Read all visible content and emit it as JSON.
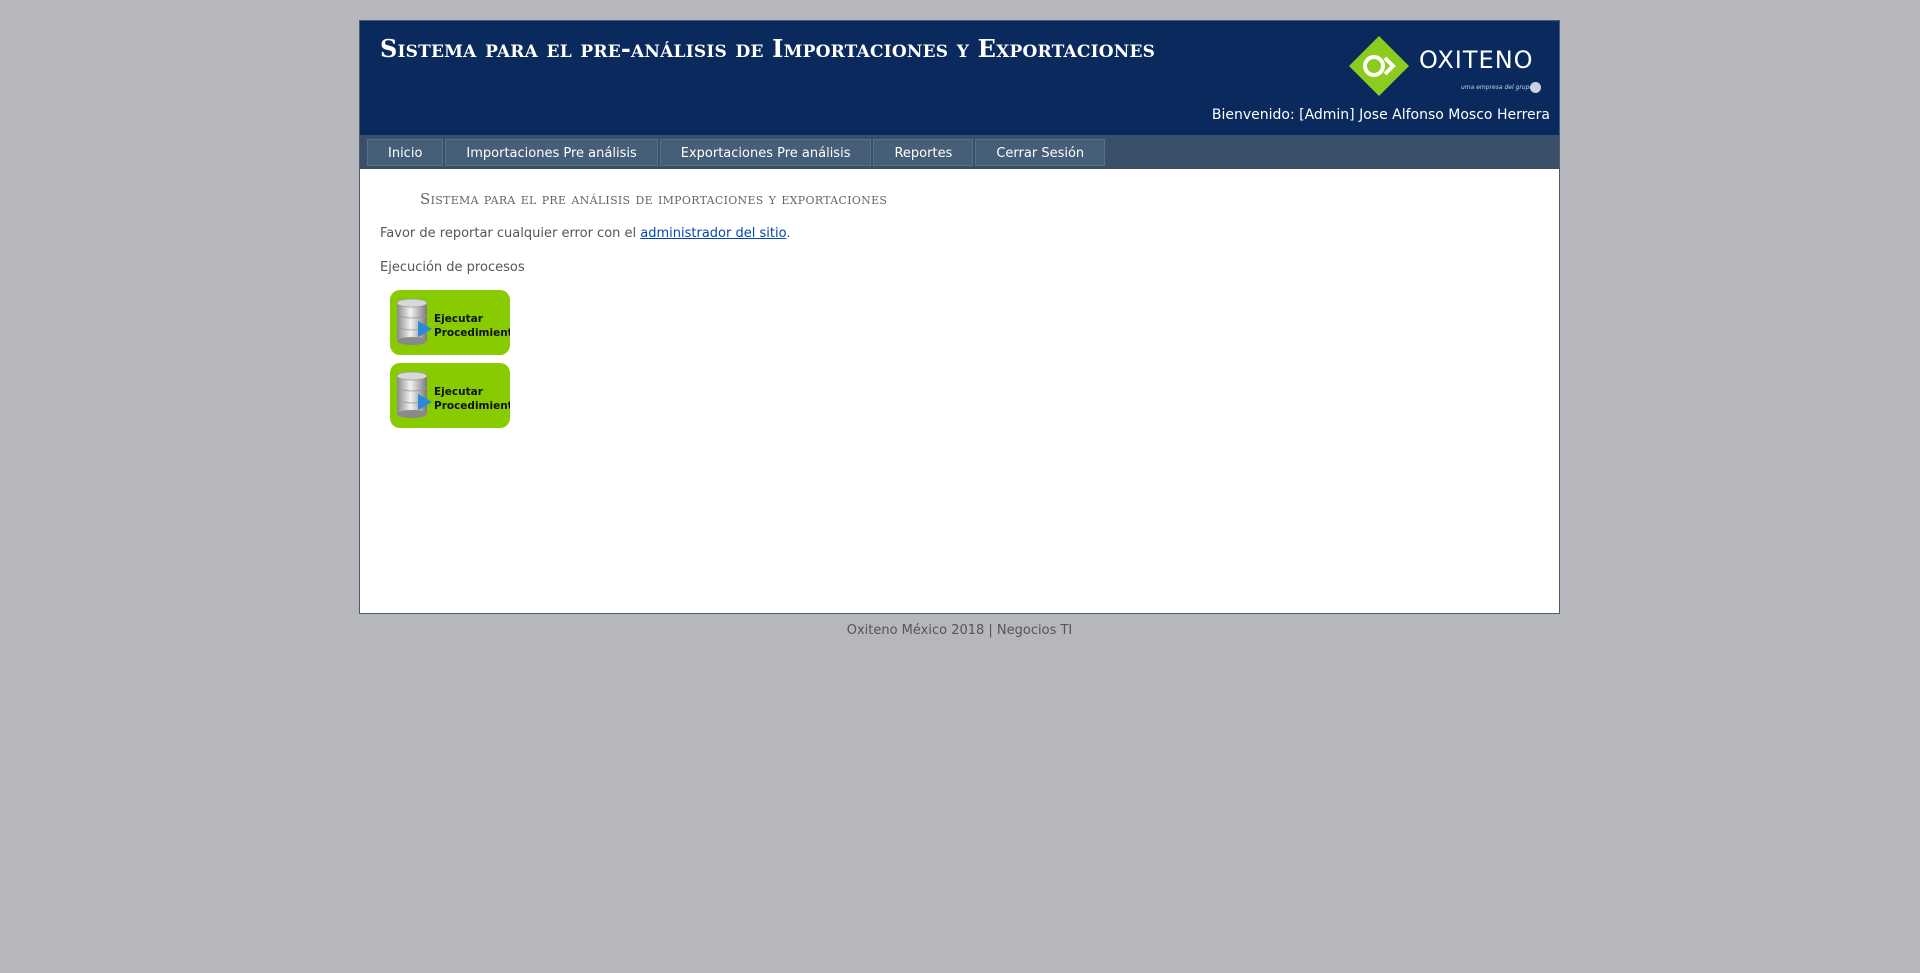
{
  "header": {
    "title": "Sistema para el pre-análisis de Importaciones y Exportaciones",
    "welcome": "Bienvenido: [Admin] Jose Alfonso Mosco Herrera",
    "logo_text": "OXITENO",
    "logo_tagline": "uma empresa del grupo"
  },
  "nav": {
    "items": [
      {
        "label": "Inicio"
      },
      {
        "label": "Importaciones Pre análisis"
      },
      {
        "label": "Exportaciones Pre análisis"
      },
      {
        "label": "Reportes"
      },
      {
        "label": "Cerrar Sesión"
      }
    ]
  },
  "main": {
    "title": "Sistema para el pre análisis de importaciones y exportaciones",
    "report_prefix": "Favor de reportar cualquier error con el ",
    "report_link": "administrador del sitio",
    "report_suffix": ".",
    "section_label": "Ejecución de procesos",
    "buttons": [
      {
        "line1": "Ejecutar",
        "line2": "Procedimiento"
      },
      {
        "line1": "Ejecutar",
        "line2": "Procedimiento"
      }
    ]
  },
  "footer": {
    "text": "Oxiteno México 2018 | Negocios TI"
  },
  "colors": {
    "header_bg": "#0a2a5e",
    "nav_bg": "#3a5068",
    "button_green": "#88cc00",
    "logo_green": "#8ccc1e",
    "page_bg": "#b5b7bc"
  },
  "icons": {
    "logo": "oxiteno-logo-icon",
    "process": "database-play-icon"
  }
}
